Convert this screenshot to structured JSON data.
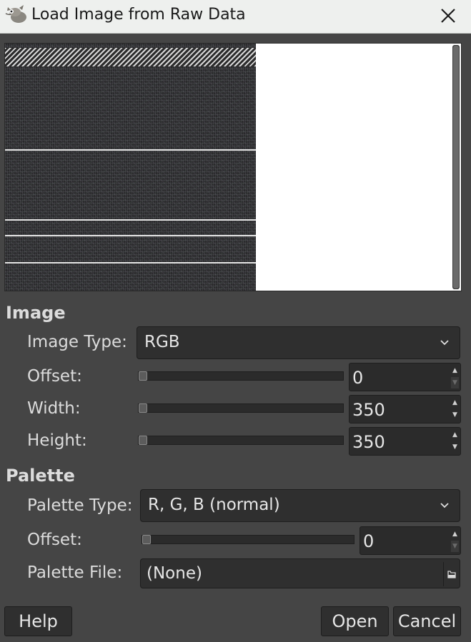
{
  "window": {
    "title": "Load Image from Raw Data",
    "app_icon": "gimp-wilber-icon",
    "close_icon": "close-icon"
  },
  "image": {
    "section_title": "Image",
    "image_type_label": "Image Type:",
    "image_type_value": "RGB",
    "offset_label": "Offset:",
    "offset_value": "0",
    "width_label": "Width:",
    "width_value": "350",
    "height_label": "Height:",
    "height_value": "350"
  },
  "palette": {
    "section_title": "Palette",
    "palette_type_label": "Palette Type:",
    "palette_type_value": "R, G, B (normal)",
    "offset_label": "Offset:",
    "offset_value": "0",
    "palette_file_label": "Palette File:",
    "palette_file_value": "(None)",
    "file_icon": "file-open-icon"
  },
  "buttons": {
    "help": "Help",
    "open": "Open",
    "cancel": "Cancel"
  },
  "colors": {
    "dialog_bg": "#454545",
    "titlebar_bg": "#eef0ee",
    "field_bg": "#2f2f2f",
    "text": "#dcdcdc"
  }
}
